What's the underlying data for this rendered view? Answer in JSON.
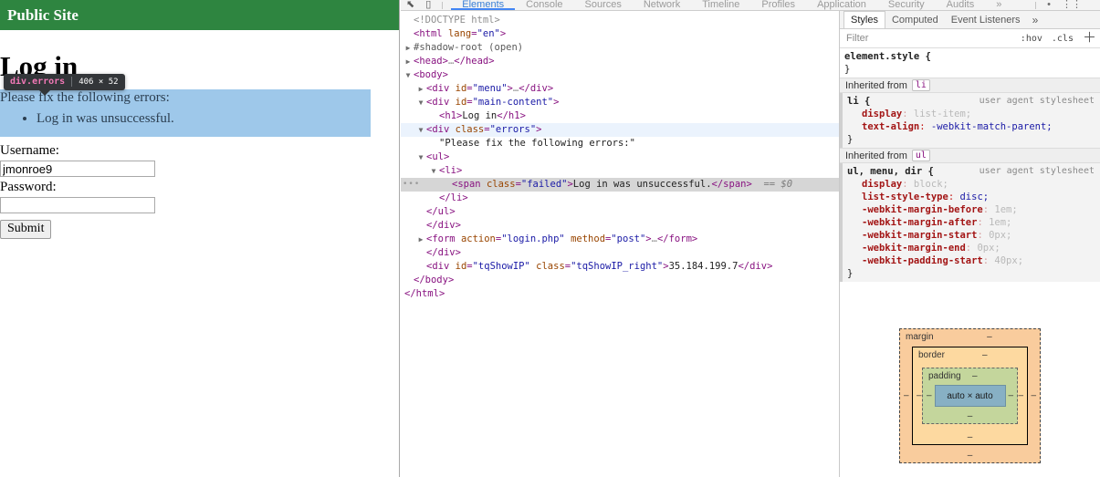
{
  "site": {
    "header_title": "Public Site",
    "header_bg": "#2e8540",
    "h1": "Log in",
    "errors": {
      "lead": "Please fix the following errors:",
      "items": [
        "Log in was unsuccessful."
      ],
      "highlight_color": "#9ec8ea"
    },
    "form": {
      "username_label": "Username:",
      "username_value": "jmonroe9",
      "username_placeholder": "",
      "password_label": "Password:",
      "password_value": "",
      "password_placeholder": "",
      "submit_label": "Submit"
    }
  },
  "inspect_badge": {
    "tag": "div.errors",
    "dimensions": "406 × 52"
  },
  "devtools": {
    "toolbar": {
      "inspect_icon": "inspect-cursor-icon",
      "device_icon": "device-toolbar-icon",
      "tabs": [
        {
          "label": "Elements",
          "active": true
        },
        {
          "label": "Console",
          "active": false
        },
        {
          "label": "Sources",
          "active": false
        },
        {
          "label": "Network",
          "active": false
        },
        {
          "label": "Timeline",
          "active": false
        },
        {
          "label": "Profiles",
          "active": false
        },
        {
          "label": "Application",
          "active": false
        },
        {
          "label": "Security",
          "active": false
        },
        {
          "label": "Audits",
          "active": false
        }
      ],
      "overflow_label": "»",
      "right_icons": [
        "error-count-icon",
        "settings-icon",
        "more-icon"
      ]
    },
    "dom_tree": [
      {
        "indent": 0,
        "twisty": "",
        "state": "",
        "html": "<span class='cm'>&lt;!DOCTYPE html&gt;</span>"
      },
      {
        "indent": 0,
        "twisty": "",
        "state": "",
        "html": "<span class='br'>&lt;</span><span class='pk'>html</span> <span class='at'>lang</span><span class='br'>=</span><span class='av'>\"en\"</span><span class='br'>&gt;</span>"
      },
      {
        "indent": 0,
        "twisty": "▶",
        "state": "",
        "html": "<span class='shadow'>#shadow-root (open)</span>"
      },
      {
        "indent": 0,
        "twisty": "▶",
        "state": "",
        "html": "<span class='br'>&lt;</span><span class='pk'>head</span><span class='br'>&gt;</span><span class='cm'>…</span><span class='br'>&lt;/</span><span class='pk'>head</span><span class='br'>&gt;</span>"
      },
      {
        "indent": 0,
        "twisty": "▼",
        "state": "",
        "html": "<span class='br'>&lt;</span><span class='pk'>body</span><span class='br'>&gt;</span>"
      },
      {
        "indent": 1,
        "twisty": "▶",
        "state": "",
        "html": "<span class='br'>&lt;</span><span class='pk'>div</span> <span class='at'>id</span><span class='br'>=</span><span class='av'>\"menu\"</span><span class='br'>&gt;</span><span class='cm'>…</span><span class='br'>&lt;/</span><span class='pk'>div</span><span class='br'>&gt;</span>"
      },
      {
        "indent": 1,
        "twisty": "▼",
        "state": "",
        "html": "<span class='br'>&lt;</span><span class='pk'>div</span> <span class='at'>id</span><span class='br'>=</span><span class='av'>\"main-content\"</span><span class='br'>&gt;</span>"
      },
      {
        "indent": 2,
        "twisty": "",
        "state": "",
        "html": "<span class='br'>&lt;</span><span class='pk'>h1</span><span class='br'>&gt;</span><span class='tx'>Log in</span><span class='br'>&lt;/</span><span class='pk'>h1</span><span class='br'>&gt;</span>"
      },
      {
        "indent": 1,
        "twisty": "▼",
        "state": "hl-hover",
        "html": "<span class='br'>&lt;</span><span class='pk'>div</span> <span class='at'>class</span><span class='br'>=</span><span class='av'>\"errors\"</span><span class='br'>&gt;</span>"
      },
      {
        "indent": 2,
        "twisty": "",
        "state": "",
        "html": "<span class='tx'>\"Please fix the following errors:\"</span>"
      },
      {
        "indent": 1,
        "twisty": "▼",
        "state": "",
        "html": "<span class='br'>&lt;</span><span class='pk'>ul</span><span class='br'>&gt;</span>"
      },
      {
        "indent": 2,
        "twisty": "▼",
        "state": "",
        "html": "<span class='br'>&lt;</span><span class='pk'>li</span><span class='br'>&gt;</span>"
      },
      {
        "indent": 3,
        "twisty": "",
        "state": "hl-sel",
        "dots": true,
        "html": "<span class='br'>&lt;</span><span class='pk'>span</span> <span class='at'>class</span><span class='br'>=</span><span class='av'>\"failed\"</span><span class='br'>&gt;</span><span class='tx'>Log in was unsuccessful.</span><span class='br'>&lt;/</span><span class='pk'>span</span><span class='br'>&gt;</span><span class='dollar'>  == $0</span>"
      },
      {
        "indent": 2,
        "twisty": "",
        "state": "",
        "html": "<span class='br'>&lt;/</span><span class='pk'>li</span><span class='br'>&gt;</span>"
      },
      {
        "indent": 1,
        "twisty": "",
        "state": "",
        "html": "<span class='br'>&lt;/</span><span class='pk'>ul</span><span class='br'>&gt;</span>"
      },
      {
        "indent": 1,
        "twisty": "",
        "state": "",
        "html": "<span class='br'>&lt;/</span><span class='pk'>div</span><span class='br'>&gt;</span>"
      },
      {
        "indent": 1,
        "twisty": "▶",
        "state": "",
        "html": "<span class='br'>&lt;</span><span class='pk'>form</span> <span class='at'>action</span><span class='br'>=</span><span class='av'>\"login.php\"</span> <span class='at'>method</span><span class='br'>=</span><span class='av'>\"post\"</span><span class='br'>&gt;</span><span class='cm'>…</span><span class='br'>&lt;/</span><span class='pk'>form</span><span class='br'>&gt;</span>"
      },
      {
        "indent": 1,
        "twisty": "",
        "state": "",
        "html": "<span class='br'>&lt;/</span><span class='pk'>div</span><span class='br'>&gt;</span>"
      },
      {
        "indent": 1,
        "twisty": "",
        "state": "",
        "html": "<span class='br'>&lt;</span><span class='pk'>div</span> <span class='at'>id</span><span class='br'>=</span><span class='av'>\"tqShowIP\"</span> <span class='at'>class</span><span class='br'>=</span><span class='av'>\"tqShowIP_right\"</span><span class='br'>&gt;</span><span class='tx'>35.184.199.7</span><span class='br'>&lt;/</span><span class='pk'>div</span><span class='br'>&gt;</span>"
      },
      {
        "indent": 0,
        "twisty": "",
        "state": "",
        "html": "<span class='br'>&lt;/</span><span class='pk'>body</span><span class='br'>&gt;</span>"
      },
      {
        "indent": -1,
        "twisty": "",
        "state": "",
        "html": "<span class='br'>&lt;/</span><span class='pk'>html</span><span class='br'>&gt;</span>"
      }
    ],
    "styles_pane": {
      "tabs": [
        {
          "label": "Styles",
          "active": true
        },
        {
          "label": "Computed",
          "active": false
        },
        {
          "label": "Event Listeners",
          "active": false
        }
      ],
      "overflow": "»",
      "filter_placeholder": "Filter",
      "hov_label": ":hov",
      "cls_label": ".cls",
      "new_rule_icon": "plus-icon",
      "rules": [
        {
          "kind": "element",
          "selector": "element.style {",
          "origin": "",
          "props": [],
          "close": "}"
        },
        {
          "kind": "inherited-header",
          "label": "Inherited from",
          "chip": "li"
        },
        {
          "kind": "ua",
          "selector": "li {",
          "origin": "user agent stylesheet",
          "props": [
            {
              "name": "display",
              "value": "list-item",
              "dim": true
            },
            {
              "name": "text-align",
              "value": "-webkit-match-parent",
              "dim": false
            }
          ],
          "close": "}"
        },
        {
          "kind": "inherited-header",
          "label": "Inherited from",
          "chip": "ul"
        },
        {
          "kind": "ua",
          "selector": "ul, menu, dir {",
          "origin": "user agent stylesheet",
          "props": [
            {
              "name": "display",
              "value": "block",
              "dim": true
            },
            {
              "name": "list-style-type",
              "value": "disc",
              "dim": false
            },
            {
              "name": "-webkit-margin-before",
              "value": "1em",
              "dim": true
            },
            {
              "name": "-webkit-margin-after",
              "value": "1em",
              "dim": true
            },
            {
              "name": "-webkit-margin-start",
              "value": "0px",
              "dim": true
            },
            {
              "name": "-webkit-margin-end",
              "value": "0px",
              "dim": true
            },
            {
              "name": "-webkit-padding-start",
              "value": "40px",
              "dim": true
            }
          ],
          "close": "}"
        }
      ]
    },
    "box_model": {
      "margin_label": "margin",
      "margin_values": {
        "top": "–",
        "right": "–",
        "bottom": "–",
        "left": "–"
      },
      "border_label": "border",
      "border_values": {
        "top": "–",
        "right": "–",
        "bottom": "–",
        "left": "–"
      },
      "padding_label": "padding",
      "padding_values": {
        "top": "–",
        "right": "–",
        "bottom": "–",
        "left": "–"
      },
      "content_size": "auto × auto"
    }
  }
}
